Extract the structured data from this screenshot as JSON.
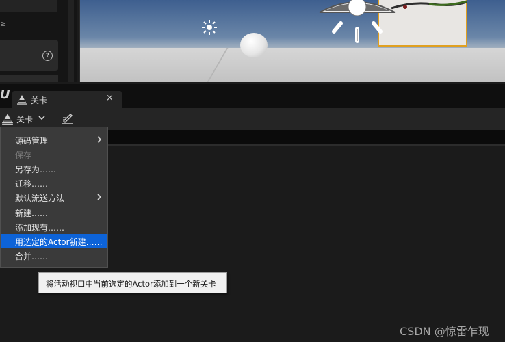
{
  "left_panel": {
    "corner_text": "≥",
    "help_icon": "help-circle-icon"
  },
  "viewport": {
    "objects": [
      "sun-light-icon",
      "sphere",
      "directional-light-gizmo",
      "picture-frame"
    ]
  },
  "level_tab": {
    "title": "关卡",
    "icon": "levels-icon",
    "close_glyph": "×"
  },
  "toolbar": {
    "levels_button_label": "关卡",
    "edit_icon": "edit-pencil-icon"
  },
  "menu": {
    "items": [
      {
        "label": "源码管理",
        "submenu": true,
        "enabled": true,
        "selected": false
      },
      {
        "label": "保存",
        "submenu": false,
        "enabled": false,
        "selected": false
      },
      {
        "label": "另存为……",
        "submenu": false,
        "enabled": true,
        "selected": false
      },
      {
        "label": "迁移……",
        "submenu": false,
        "enabled": true,
        "selected": false
      },
      {
        "label": "默认流送方法",
        "submenu": true,
        "enabled": true,
        "selected": false
      },
      {
        "label": "新建……",
        "submenu": false,
        "enabled": true,
        "selected": false
      },
      {
        "label": "添加现有……",
        "submenu": false,
        "enabled": true,
        "selected": false
      },
      {
        "label": "用选定的Actor新建……",
        "submenu": false,
        "enabled": true,
        "selected": true
      },
      {
        "label": "合并……",
        "submenu": false,
        "enabled": true,
        "selected": false
      }
    ]
  },
  "tooltip": {
    "text": "将活动视口中当前选定的Actor添加到一个新关卡"
  },
  "watermark": {
    "text": "CSDN @惊雷乍现"
  },
  "colors": {
    "selection": "#0d63d8",
    "background": "#1b1b1b",
    "menu_bg": "#3a3a3a",
    "tooltip_bg": "#f1f1f1"
  }
}
